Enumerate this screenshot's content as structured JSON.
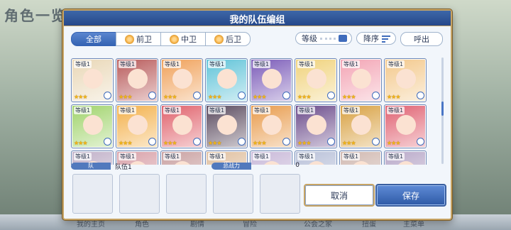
{
  "background": {
    "title": "角色一览",
    "bottom_tabs": [
      "我的主页",
      "角色",
      "剧情",
      "冒险",
      "公会之家",
      "扭蛋",
      "主菜单"
    ]
  },
  "dialog": {
    "title": "我的队伍编组",
    "tabs": [
      {
        "label": "全部",
        "active": true
      },
      {
        "label": "前卫",
        "active": false
      },
      {
        "label": "中卫",
        "active": false
      },
      {
        "label": "后卫",
        "active": false
      }
    ],
    "sort_field": "等级",
    "sort_order": "降序",
    "call_out": "呼出",
    "card_level_label": "等级1",
    "rows": [
      {
        "cards": [
          {
            "level": "等级1",
            "stars": "★★★",
            "color": "#e9d7b6"
          },
          {
            "level": "等级1",
            "stars": "★★★",
            "color": "#b85a5a"
          },
          {
            "level": "等级1",
            "stars": "★★★",
            "color": "#f0a058"
          },
          {
            "level": "等级1",
            "stars": "★★★",
            "color": "#5fc3d8"
          },
          {
            "level": "等级1",
            "stars": "★★★",
            "color": "#7a5ab8"
          },
          {
            "level": "等级1",
            "stars": "★★★",
            "color": "#f0d27a"
          },
          {
            "level": "等级1",
            "stars": "★★★",
            "color": "#f3a4b4"
          },
          {
            "level": "等级1",
            "stars": "★★★",
            "color": "#f3c88a"
          }
        ]
      },
      {
        "cards": [
          {
            "level": "等级1",
            "stars": "★★★",
            "color": "#9fd36a"
          },
          {
            "level": "等级1",
            "stars": "★★★",
            "color": "#f3b04a"
          },
          {
            "level": "等级1",
            "stars": "★★★",
            "color": "#e0606a"
          },
          {
            "level": "等级1",
            "stars": "★★★",
            "color": "#5a4a5e"
          },
          {
            "level": "等级1",
            "stars": "★★★",
            "color": "#e89a4a"
          },
          {
            "level": "等级1",
            "stars": "★★★",
            "color": "#6a4a8a"
          },
          {
            "level": "等级1",
            "stars": "★★★",
            "color": "#d8a040"
          },
          {
            "level": "等级1",
            "stars": "★★★",
            "color": "#e06070"
          }
        ]
      },
      {
        "cards": [
          {
            "level": "等级1",
            "stars": "",
            "color": "#c0b0c8"
          },
          {
            "level": "等级1",
            "stars": "",
            "color": "#d8a0a8"
          },
          {
            "level": "等级1",
            "stars": "",
            "color": "#c9a0a0"
          },
          {
            "level": "等级1",
            "stars": "",
            "color": "#e0c0a0"
          },
          {
            "level": "等级1",
            "stars": "",
            "color": "#c8b8d8"
          },
          {
            "level": "等级1",
            "stars": "",
            "color": "#b8c0d8"
          },
          {
            "level": "等级1",
            "stars": "",
            "color": "#d0b8b0"
          },
          {
            "level": "等级1",
            "stars": "",
            "color": "#b8a8c8"
          }
        ]
      }
    ],
    "team_label": "队",
    "team_name": "队伍1",
    "power_label": "总战力",
    "power_value": "0",
    "cancel_label": "取消",
    "save_label": "保存"
  }
}
